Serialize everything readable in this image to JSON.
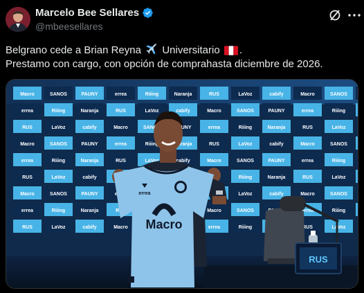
{
  "author": {
    "display_name": "Marcelo Bee Sellares",
    "handle": "@mbeesellares",
    "avatar_icon": "profile-photo",
    "verified_icon": "verified-badge-icon",
    "verified_color": "#1d9bf0"
  },
  "actions": {
    "grok_icon": "grok-icon",
    "more_icon": "more-options-icon"
  },
  "tweet": {
    "line1_part1": "Belgrano cede a Brian Reyna",
    "line1_part2": "Universitario",
    "line1_end": ".",
    "line2": "Prestamo con cargo, con opción de comprahasta diciembre de 2026."
  },
  "media": {
    "description_icon": "press-conference-photo",
    "shirt_sponsor": "Macro",
    "shirt_brand": "errea",
    "desk_badge": "RUS",
    "backdrop_brands": [
      "Macro",
      "SANOS",
      "PAUNY",
      "errea",
      "Riiing",
      "Naranja",
      "RUS",
      "LaVoz",
      "cabify"
    ],
    "colors": {
      "backdrop_light": "#48b3e6",
      "backdrop_dark": "#0d2a4f",
      "shirt": "#8fc4ea",
      "text_dark": "#0e1a2b"
    }
  }
}
